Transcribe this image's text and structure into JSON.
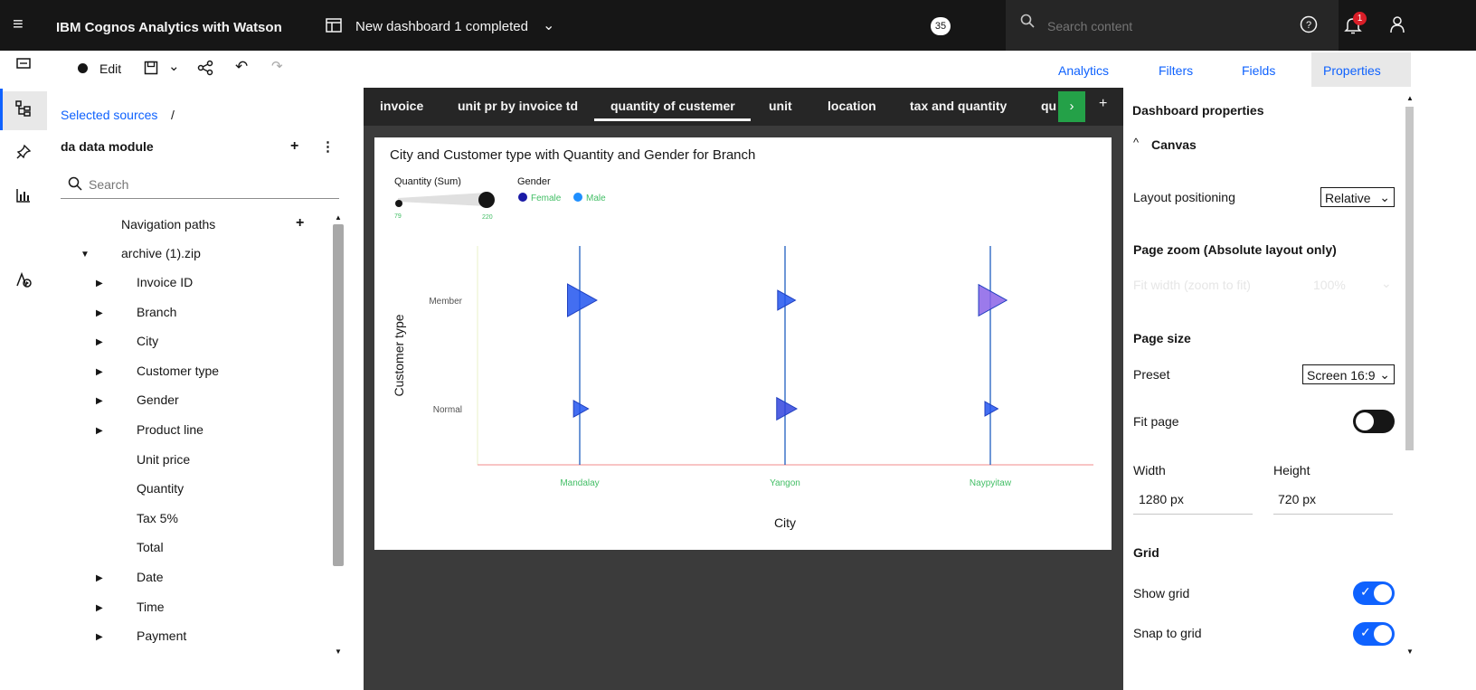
{
  "app": {
    "title": "IBM Cognos Analytics with Watson",
    "doc_title": "New dashboard 1 completed",
    "badge": "35",
    "search_placeholder": "Search content",
    "notif_count": "1"
  },
  "toolbar": {
    "edit_label": "Edit",
    "right_tabs": [
      "Analytics",
      "Filters",
      "Fields",
      "Properties"
    ]
  },
  "sources": {
    "breadcrumb": "Selected sources",
    "breadcrumb_sep": "/",
    "module_name": "da data module",
    "search_placeholder": "Search",
    "nav_paths": "Navigation paths",
    "archive": "archive (1).zip",
    "items": [
      "Invoice ID",
      "Branch",
      "City",
      "Customer type",
      "Gender",
      "Product line",
      "Unit price",
      "Quantity",
      "Tax 5%",
      "Total",
      "Date",
      "Time",
      "Payment"
    ]
  },
  "dashboard": {
    "tabs": [
      "invoice",
      "unit pr by invoice td",
      "quantity of custemer",
      "unit",
      "location",
      "tax and quantity",
      "qu"
    ]
  },
  "chart_data": {
    "type": "scatter",
    "title": "City and Customer type with Quantity and Gender for Branch",
    "xlabel": "City",
    "ylabel": "Customer type",
    "categories_x": [
      "Mandalay",
      "Yangon",
      "Naypyitaw"
    ],
    "categories_y": [
      "Member",
      "Normal"
    ],
    "size_legend": {
      "title": "Quantity (Sum)",
      "min": "79",
      "max": "220"
    },
    "color_legend": {
      "title": "Gender",
      "entries": [
        {
          "name": "Female",
          "color": "#1a1aa6"
        },
        {
          "name": "Male",
          "color": "#1f8fff"
        }
      ]
    },
    "points": [
      {
        "x": "Mandalay",
        "y": "Member",
        "size": 220,
        "color": "#2255ee"
      },
      {
        "x": "Yangon",
        "y": "Member",
        "size": 120,
        "color": "#2255ee"
      },
      {
        "x": "Naypyitaw",
        "y": "Member",
        "size": 210,
        "color": "#8a63e8"
      },
      {
        "x": "Mandalay",
        "y": "Normal",
        "size": 95,
        "color": "#2255ee"
      },
      {
        "x": "Yangon",
        "y": "Normal",
        "size": 140,
        "color": "#3344dd"
      },
      {
        "x": "Naypyitaw",
        "y": "Normal",
        "size": 79,
        "color": "#2255ee"
      }
    ]
  },
  "props": {
    "header": "Dashboard properties",
    "canvas": "Canvas",
    "layout_positioning": "Layout positioning",
    "layout_value": "Relative",
    "page_zoom": "Page zoom (Absolute layout only)",
    "zoom_disabled_label": "Fit width (zoom to fit)",
    "zoom_disabled_value": "100%",
    "page_size": "Page size",
    "preset": "Preset",
    "preset_value": "Screen 16:9",
    "fit_page": "Fit page",
    "width_label": "Width",
    "height_label": "Height",
    "width_value": "1280 px",
    "height_value": "720 px",
    "grid": "Grid",
    "show_grid": "Show grid",
    "snap_grid": "Snap to grid"
  }
}
